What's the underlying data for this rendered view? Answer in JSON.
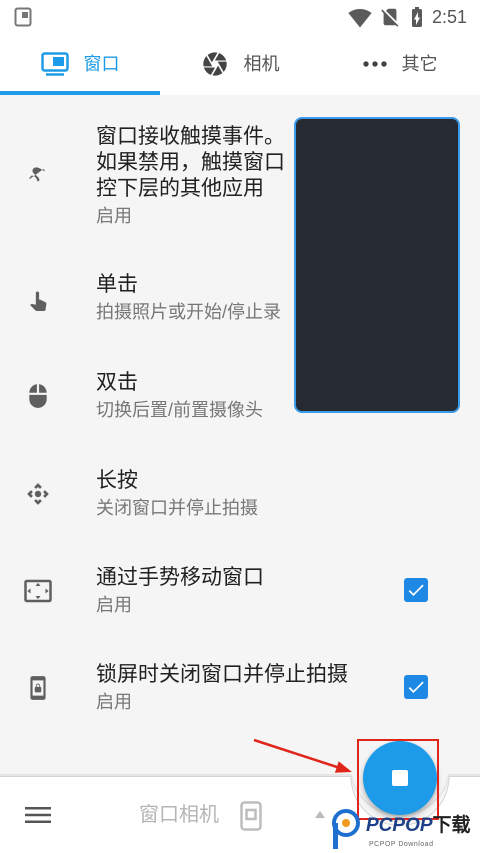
{
  "status_bar": {
    "time": "2:51",
    "icons": {
      "left": "notification-app-icon",
      "wifi": "wifi-icon",
      "sim": "no-sim-icon",
      "battery": "battery-charging-icon"
    }
  },
  "tabs": [
    {
      "label": "窗口",
      "icon": "window-icon",
      "selected": true
    },
    {
      "label": "相机",
      "icon": "aperture-icon",
      "selected": false
    },
    {
      "label": "其它",
      "icon": "more-dots-icon",
      "selected": false
    }
  ],
  "settings": [
    {
      "icon": "gesture-icon",
      "title_lines": [
        "窗口接收触摸事件。",
        "如果禁用，触摸窗口",
        "控下层的其他应用"
      ],
      "subtitle": "启用"
    },
    {
      "icon": "touch-icon",
      "title": "单击",
      "subtitle": "拍摄照片或开始/停止录"
    },
    {
      "icon": "mouse-icon",
      "title": "双击",
      "subtitle": "切换后置/前置摄像头"
    },
    {
      "icon": "move-icon",
      "title": "长按",
      "subtitle": "关闭窗口并停止拍摄"
    },
    {
      "icon": "fullscreen-icon",
      "title": "通过手势移动窗口",
      "subtitle": "启用",
      "checked": true
    },
    {
      "icon": "lock-screen-icon",
      "title": "锁屏时关闭窗口并停止拍摄",
      "subtitle": "启用",
      "checked": true
    }
  ],
  "bottom_bar": {
    "title": "窗口相机",
    "menu_icon": "menu-icon",
    "app_icon": "app-window-icon",
    "expand_icon": "expand-up-icon"
  },
  "fab": {
    "icon": "stop-icon"
  },
  "watermark": {
    "brand_latin": "PCPOP",
    "brand_cjk": "下载",
    "subtitle": "PCPOP Download"
  },
  "colors": {
    "accent": "#1e9be8",
    "checkbox": "#1e88e5",
    "floating_window_bg": "#252a33",
    "floating_window_border": "#3b9be8",
    "fab": "#1e9be8",
    "annotation": "#e0261b"
  }
}
